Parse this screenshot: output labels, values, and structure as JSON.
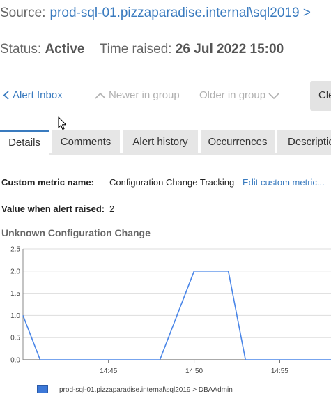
{
  "header": {
    "source_label": "Source:",
    "source_value": "prod-sql-01.pizzaparadise.internal\\sql2019 >",
    "status_label": "Status:",
    "status_value": "Active",
    "time_label": "Time raised:",
    "time_value": "26 Jul 2022 15:00"
  },
  "nav": {
    "inbox": "Alert Inbox",
    "newer": "Newer in group",
    "older": "Older in group",
    "clear": "Cle"
  },
  "tabs": [
    {
      "label": "Details",
      "active": true
    },
    {
      "label": "Comments",
      "active": false
    },
    {
      "label": "Alert history",
      "active": false
    },
    {
      "label": "Occurrences",
      "active": false
    },
    {
      "label": "Description",
      "active": false
    }
  ],
  "details": {
    "metric_label": "Custom metric name:",
    "metric_value": "Configuration Change Tracking",
    "metric_link": "Edit custom metric...",
    "value_label": "Value when alert raised:",
    "value_value": "2"
  },
  "chart_title": "Unknown Configuration Change",
  "chart_data": {
    "type": "line",
    "title": "Unknown Configuration Change",
    "xlabel": "",
    "ylabel": "",
    "x_ticks": [
      "14:45",
      "14:50",
      "14:55"
    ],
    "y_ticks": [
      "0.0",
      "0.5",
      "1.0",
      "1.5",
      "2.0",
      "2.5"
    ],
    "ylim": [
      0,
      2.5
    ],
    "xlim": [
      "14:40",
      "14:58"
    ],
    "grid": true,
    "series": [
      {
        "name": "prod-sql-01.pizzaparadise.internal\\sql2019 > DBAAdmin",
        "color": "#4a86e8",
        "x": [
          "14:40",
          "14:41",
          "14:48",
          "14:50",
          "14:52",
          "14:53",
          "14:58"
        ],
        "values": [
          1,
          0,
          0,
          2,
          2,
          0,
          0
        ]
      }
    ],
    "legend_position": "bottom-left"
  }
}
